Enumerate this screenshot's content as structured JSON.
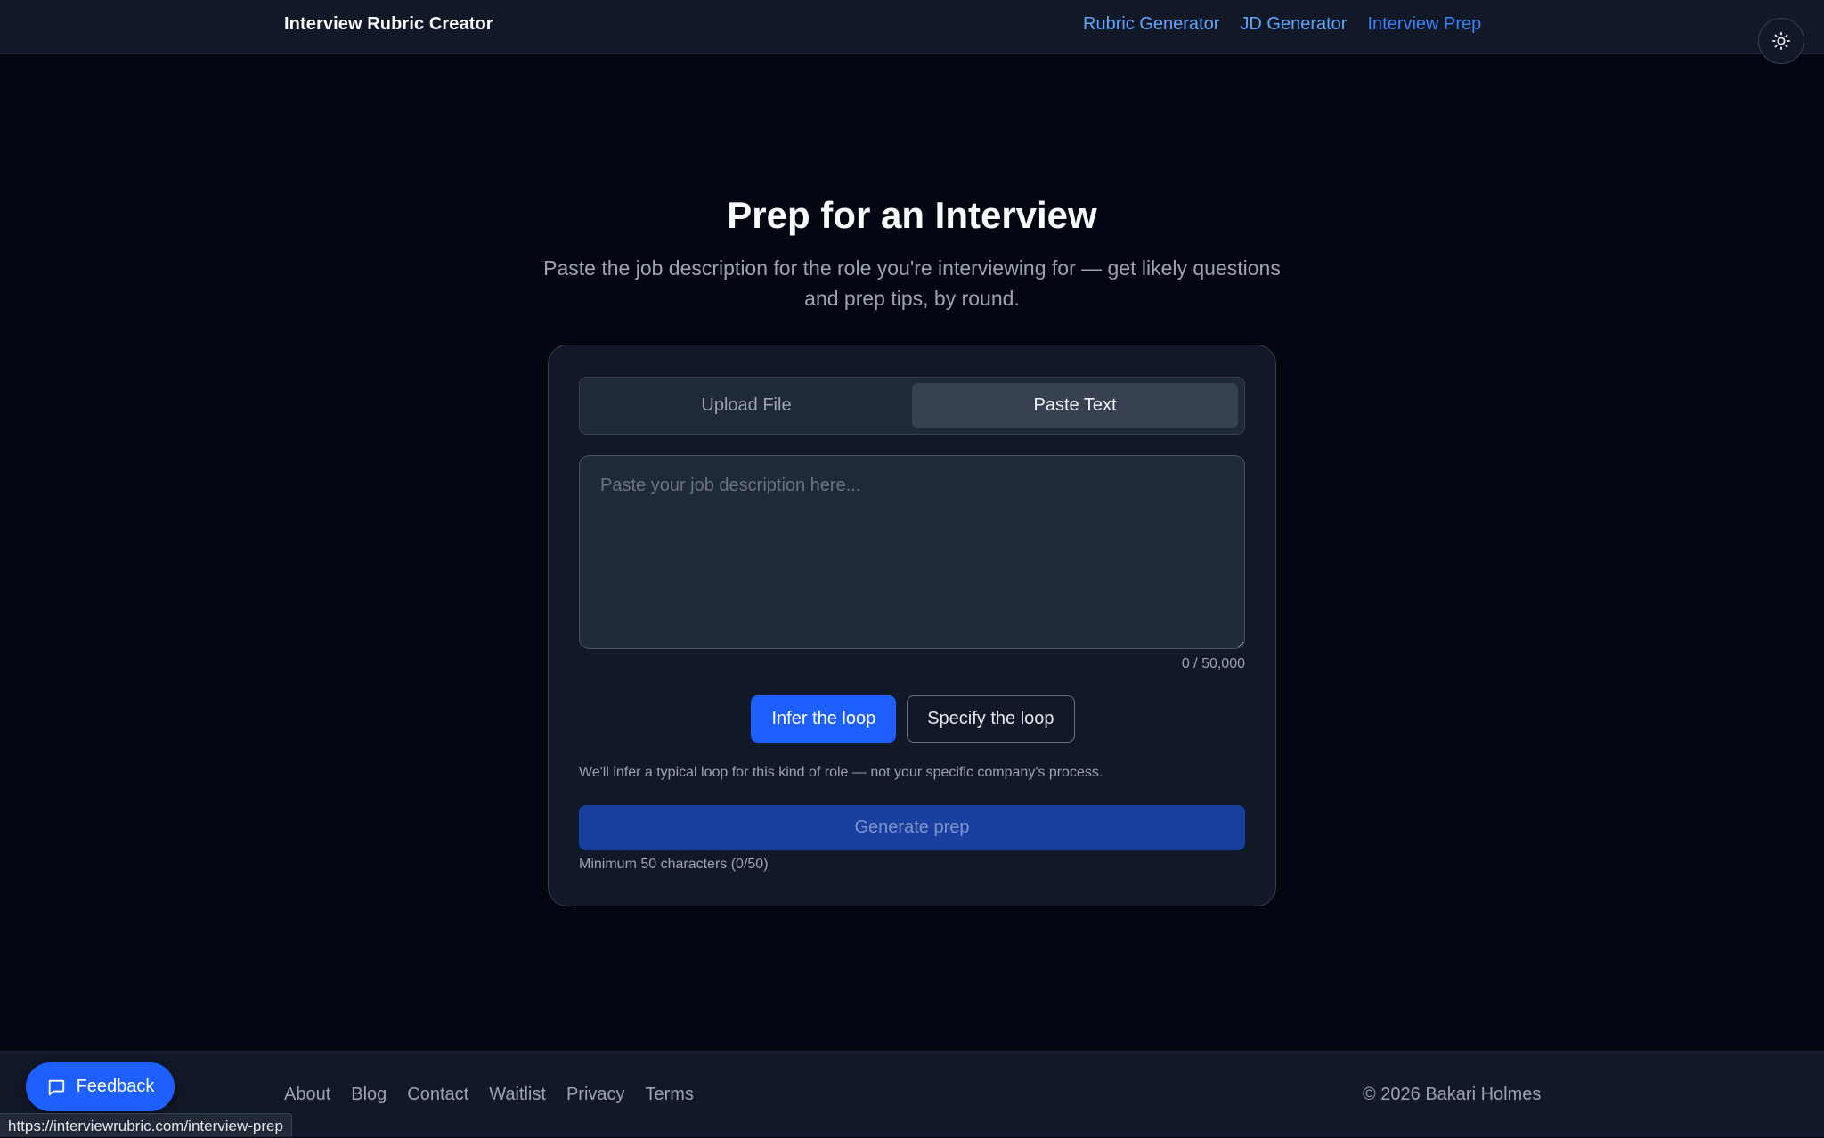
{
  "header": {
    "brand": "Interview Rubric Creator",
    "nav": [
      {
        "label": "Rubric Generator"
      },
      {
        "label": "JD Generator"
      },
      {
        "label": "Interview Prep"
      }
    ],
    "theme_toggle_icon": "sun-icon"
  },
  "main": {
    "title": "Prep for an Interview",
    "subtitle": "Paste the job description for the role you're interviewing for — get likely questions and prep tips, by round.",
    "tabs": [
      {
        "label": "Upload File",
        "active": false
      },
      {
        "label": "Paste Text",
        "active": true
      }
    ],
    "textarea": {
      "placeholder": "Paste your job description here...",
      "value": ""
    },
    "char_count": "0 / 50,000",
    "loop_options": [
      {
        "label": "Infer the loop",
        "selected": true
      },
      {
        "label": "Specify the loop",
        "selected": false
      }
    ],
    "helper": "We'll infer a typical loop for this kind of role — not your specific company's process.",
    "generate_label": "Generate prep",
    "min_note": "Minimum 50 characters (0/50)"
  },
  "footer": {
    "links": [
      {
        "label": "About"
      },
      {
        "label": "Blog"
      },
      {
        "label": "Contact"
      },
      {
        "label": "Waitlist"
      },
      {
        "label": "Privacy"
      },
      {
        "label": "Terms"
      }
    ],
    "copyright": "© 2026 Bakari Holmes"
  },
  "feedback": {
    "label": "Feedback",
    "icon": "message-icon"
  },
  "status_bar": {
    "url": "https://interviewrubric.com/interview-prep"
  },
  "colors": {
    "accent": "#1d5fff",
    "nav_link": "#60a5fa",
    "background": "#030712"
  }
}
